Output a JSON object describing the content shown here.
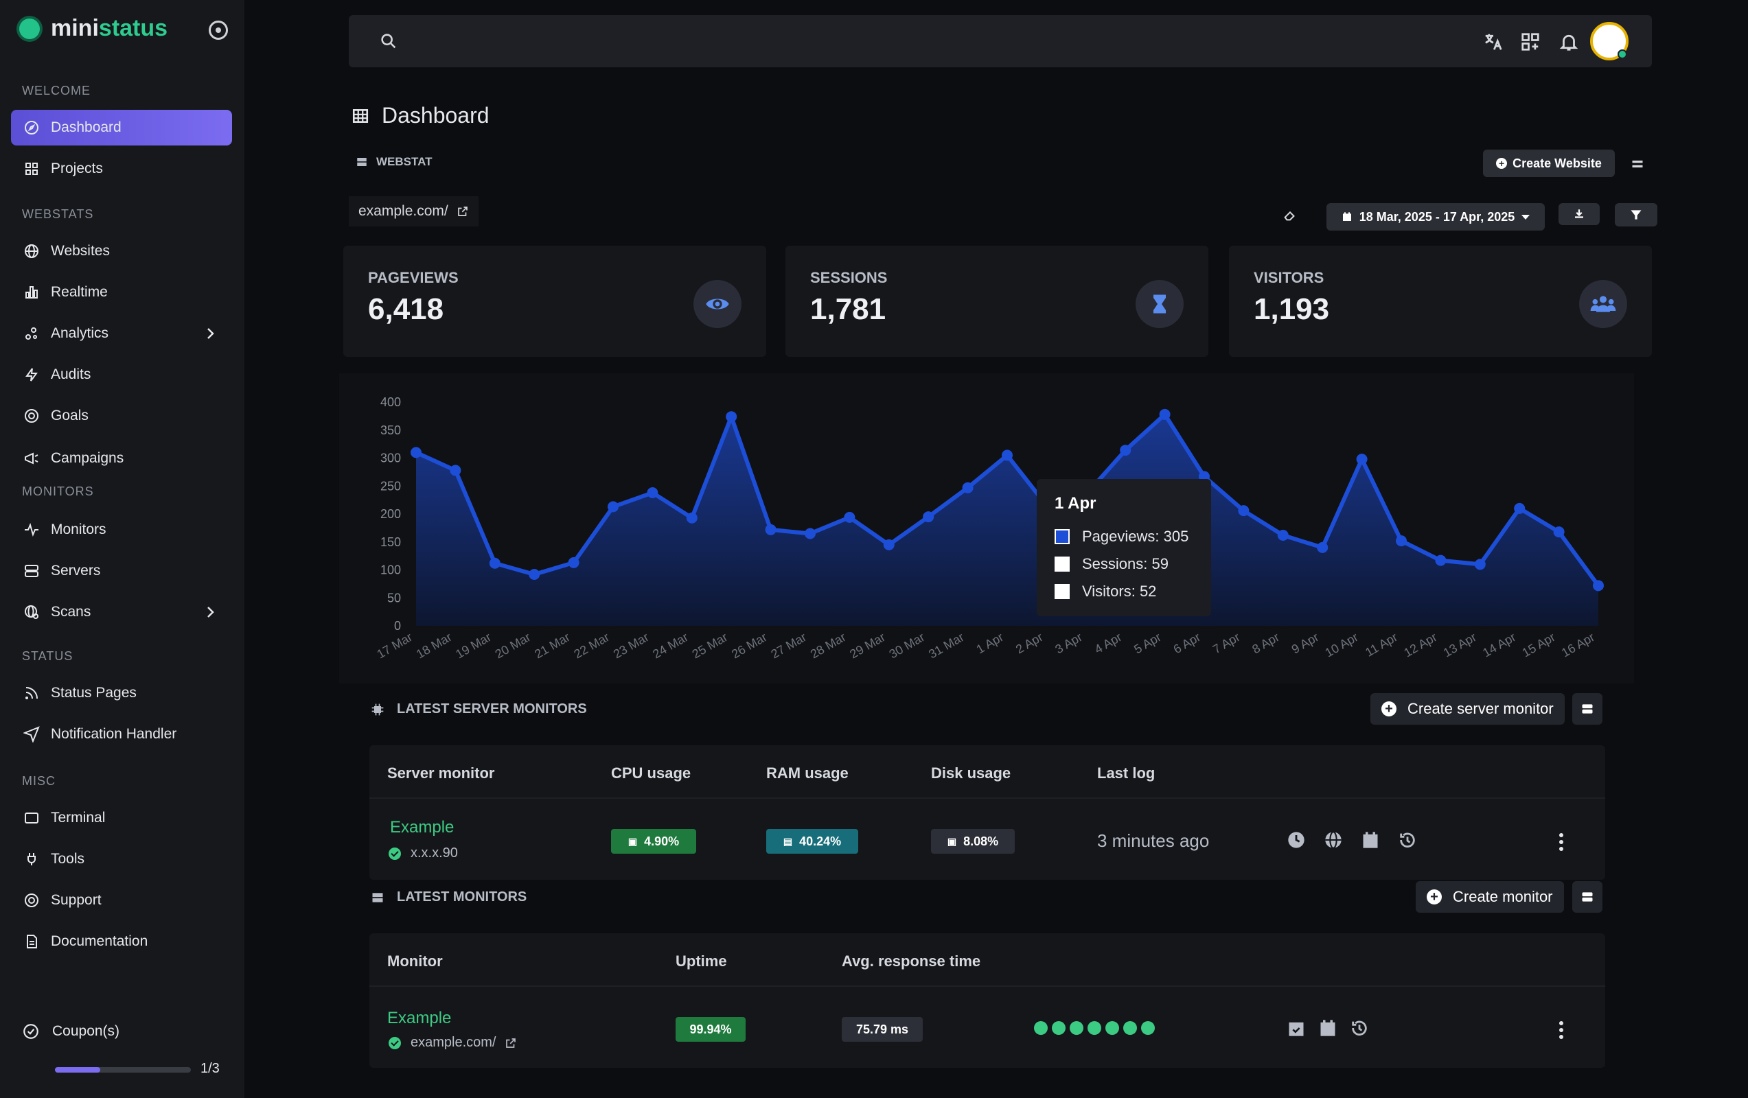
{
  "brand": {
    "prefix": "mini",
    "accent": "status"
  },
  "sidebar": {
    "sections": [
      "WELCOME",
      "WEBSTATS",
      "MONITORS",
      "STATUS",
      "MISC"
    ],
    "items": [
      {
        "label": "Dashboard",
        "icon": "compass-icon",
        "active": true
      },
      {
        "label": "Projects",
        "icon": "grid-icon"
      },
      {
        "label": "Websites",
        "icon": "globe-icon"
      },
      {
        "label": "Realtime",
        "icon": "bar-chart-icon"
      },
      {
        "label": "Analytics",
        "icon": "analytics-icon"
      },
      {
        "label": "Audits",
        "icon": "bolt-icon"
      },
      {
        "label": "Goals",
        "icon": "target-icon"
      },
      {
        "label": "Campaigns",
        "icon": "megaphone-icon"
      },
      {
        "label": "Monitors",
        "icon": "pulse-icon"
      },
      {
        "label": "Servers",
        "icon": "server-icon"
      },
      {
        "label": "Scans",
        "icon": "globe-scan-icon"
      },
      {
        "label": "Status Pages",
        "icon": "rss-icon"
      },
      {
        "label": "Notification Handler",
        "icon": "send-icon"
      },
      {
        "label": "Terminal",
        "icon": "terminal-icon"
      },
      {
        "label": "Tools",
        "icon": "plug-icon"
      },
      {
        "label": "Support",
        "icon": "lifebuoy-icon"
      },
      {
        "label": "Documentation",
        "icon": "document-icon"
      }
    ],
    "coupon_label": "Coupon(s)",
    "coupon_progress": "1/3",
    "coupon_fraction": 0.333
  },
  "page": {
    "title": "Dashboard"
  },
  "webstat": {
    "label": "WEBSTAT",
    "create_label": "Create Website",
    "url": "example.com/",
    "date_range": "18 Mar, 2025 - 17 Apr, 2025"
  },
  "stats": [
    {
      "label": "PAGEVIEWS",
      "value": "6,418",
      "icon": "eye-icon"
    },
    {
      "label": "SESSIONS",
      "value": "1,781",
      "icon": "hourglass-icon"
    },
    {
      "label": "VISITORS",
      "value": "1,193",
      "icon": "users-icon"
    }
  ],
  "chart_data": {
    "type": "area",
    "categories": [
      "17 Mar",
      "18 Mar",
      "19 Mar",
      "20 Mar",
      "21 Mar",
      "22 Mar",
      "23 Mar",
      "24 Mar",
      "25 Mar",
      "26 Mar",
      "27 Mar",
      "28 Mar",
      "29 Mar",
      "30 Mar",
      "31 Mar",
      "1 Apr",
      "2 Apr",
      "3 Apr",
      "4 Apr",
      "5 Apr",
      "6 Apr",
      "7 Apr",
      "8 Apr",
      "9 Apr",
      "10 Apr",
      "11 Apr",
      "12 Apr",
      "13 Apr",
      "14 Apr",
      "15 Apr",
      "16 Apr"
    ],
    "series": [
      {
        "name": "Pageviews",
        "values": [
          310,
          278,
          112,
          92,
          113,
          213,
          238,
          193,
          374,
          172,
          165,
          194,
          145,
          195,
          247,
          305,
          215,
          235,
          314,
          378,
          267,
          206,
          162,
          140,
          298,
          152,
          117,
          110,
          210,
          168,
          72
        ]
      }
    ],
    "ylim": [
      0,
      400
    ],
    "yticks": [
      0,
      50,
      100,
      150,
      200,
      250,
      300,
      350,
      400
    ],
    "tooltip": {
      "title": "1 Apr",
      "rows": [
        "Pageviews: 305",
        "Sessions: 59",
        "Visitors: 52"
      ]
    },
    "colors": {
      "line": "#1d4ed8",
      "fill": "#12307a"
    }
  },
  "server_monitors": {
    "title": "LATEST SERVER MONITORS",
    "create_label": "Create server monitor",
    "headers": [
      "Server monitor",
      "CPU usage",
      "RAM usage",
      "Disk usage",
      "Last log"
    ],
    "rows": [
      {
        "name": "Example",
        "ip": "x.x.x.90",
        "cpu": "4.90%",
        "ram": "40.24%",
        "disk": "8.08%",
        "last_log": "3 minutes ago"
      }
    ]
  },
  "monitors": {
    "title": "LATEST MONITORS",
    "create_label": "Create monitor",
    "headers": [
      "Monitor",
      "Uptime",
      "Avg. response time"
    ],
    "rows": [
      {
        "name": "Example",
        "url": "example.com/",
        "uptime": "99.94%",
        "avg": "75.79 ms"
      }
    ]
  }
}
